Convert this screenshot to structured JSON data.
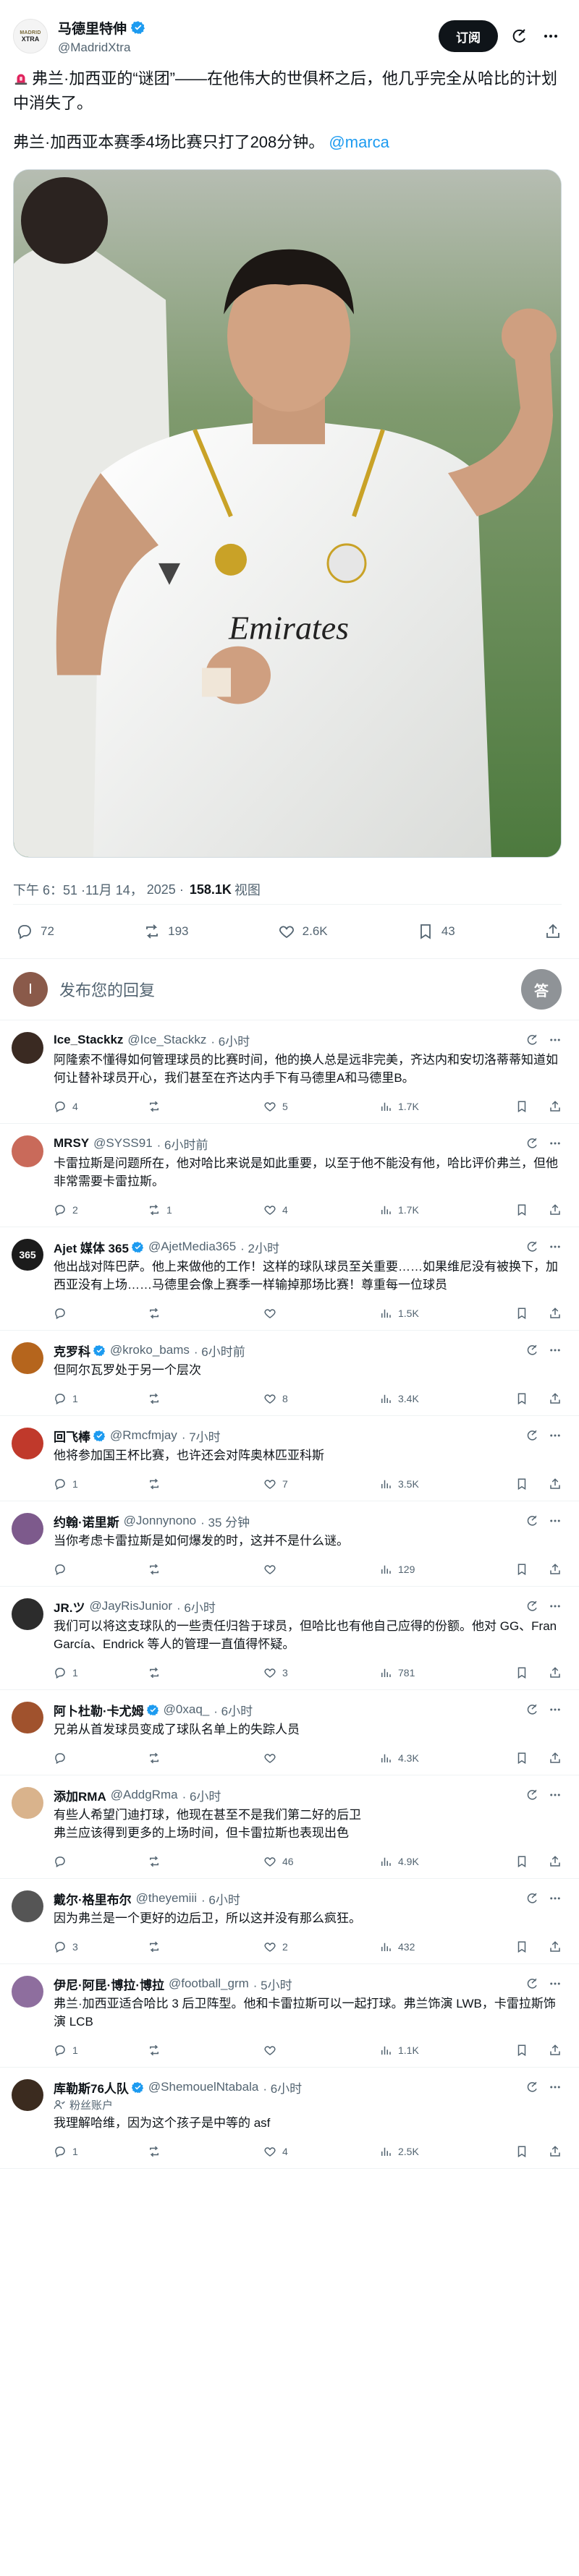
{
  "header": {
    "avatar_top": "MADRID",
    "avatar_bottom": "XTRA",
    "name": "马德里特伸",
    "handle": "@MadridXtra",
    "subscribe_label": "订阅"
  },
  "post": {
    "text_1": "弗兰·加西亚的“谜团”——在他伟大的世俱杯之后，他几乎完全从哈比的计划中消失了。",
    "text_2": "弗兰·加西亚本赛季4场比赛只打了208分钟。",
    "mention": "@marca",
    "image_jersey_sponsor": "Emirates",
    "time": "下午 6：51 ·11月 14，",
    "year": "2025",
    "views": "158.1K",
    "views_label": "视图",
    "replies": "72",
    "reposts": "193",
    "likes": "2.6K",
    "bookmarks": "43"
  },
  "reply_box": {
    "avatar_letter": "I",
    "placeholder": "发布您的回复",
    "button_label": "答"
  },
  "replies": [
    {
      "name": "Ice_Stackkz",
      "handle": "@Ice_Stackkz",
      "time": "· 6小时",
      "verified": false,
      "text": "阿隆索不懂得如何管理球员的比赛时间，他的换人总是远非完美，齐达内和安切洛蒂蒂知道如何让替补球员开心，我们甚至在齐达内手下有马德里A和马德里B。",
      "replies": "4",
      "reposts": "",
      "likes": "5",
      "views": "1.7K",
      "color": "#3a2a22"
    },
    {
      "name": "MRSY",
      "handle": "@SYSS91",
      "time": "· 6小时前",
      "verified": false,
      "text": "卡雷拉斯是问题所在，他对哈比来说是如此重要，以至于他不能没有他，哈比评价弗兰，但他非常需要卡雷拉斯。",
      "replies": "2",
      "reposts": "1",
      "likes": "4",
      "views": "1.7K",
      "color": "#c96a5a"
    },
    {
      "name": "Ajet 媒体 365",
      "handle": "@AjetMedia365",
      "time": "· 2小时",
      "verified": true,
      "text": "他出战对阵巴萨。他上来做他的工作！这样的球队球员至关重要……如果维尼没有被换下，加西亚没有上场……马德里会像上赛季一样输掉那场比赛！尊重每一位球员",
      "replies": "",
      "reposts": "",
      "likes": "",
      "views": "1.5K",
      "color": "#1b1b1b",
      "avatar_text": "365"
    },
    {
      "name": "克罗科",
      "handle": "@kroko_bams",
      "time": "· 6小时前",
      "verified": true,
      "text": "但阿尔瓦罗处于另一个层次",
      "replies": "1",
      "reposts": "",
      "likes": "8",
      "views": "3.4K",
      "color": "#b5651d"
    },
    {
      "name": "回飞棒",
      "handle": "@Rmcfmjay",
      "time": "· 7小时",
      "verified": true,
      "text": "他将参加国王杯比赛，也许还会对阵奥林匹亚科斯",
      "replies": "1",
      "reposts": "",
      "likes": "7",
      "views": "3.5K",
      "color": "#c0392b"
    },
    {
      "name": "约翰·诺里斯",
      "handle": "@Jonnynono",
      "time": "· 35 分钟",
      "verified": false,
      "text": "当你考虑卡雷拉斯是如何爆发的时，这并不是什么谜。",
      "replies": "",
      "reposts": "",
      "likes": "",
      "views": "129",
      "color": "#7d5a8c"
    },
    {
      "name": "JR.ツ",
      "handle": "@JayRisJunior",
      "time": "· 6小时",
      "verified": false,
      "text": "我们可以将这支球队的一些责任归咎于球员，但哈比也有他自己应得的份额。他对 GG、Fran García、Endrick 等人的管理一直值得怀疑。",
      "replies": "1",
      "reposts": "",
      "likes": "3",
      "views": "781",
      "color": "#2c2c2c"
    },
    {
      "name": "阿卜杜勒·卡尤姆",
      "handle": "@0xaq_",
      "time": "· 6小时",
      "verified": true,
      "text": "兄弟从首发球员变成了球队名单上的失踪人员",
      "replies": "",
      "reposts": "",
      "likes": "",
      "views": "4.3K",
      "color": "#a0522d"
    },
    {
      "name": "添加RMA",
      "handle": "@AddgRma",
      "time": "· 6小时",
      "verified": false,
      "text": "有些人希望门迪打球，他现在甚至不是我们第二好的后卫\n弗兰应该得到更多的上场时间，但卡雷拉斯也表现出色",
      "replies": "",
      "reposts": "",
      "likes": "46",
      "views": "4.9K",
      "color": "#d9b38c"
    },
    {
      "name": "戴尔·格里布尔",
      "handle": "@theyemiii",
      "time": "· 6小时",
      "verified": false,
      "text": "因为弗兰是一个更好的边后卫，所以这并没有那么疯狂。",
      "replies": "3",
      "reposts": "",
      "likes": "2",
      "views": "432",
      "color": "#555"
    },
    {
      "name": "伊尼·阿昆·博拉·博拉",
      "handle": "@football_grm",
      "time": "· 5小时",
      "verified": false,
      "text": "弗兰·加西亚适合哈比 3 后卫阵型。他和卡雷拉斯可以一起打球。弗兰饰演 LWB，卡雷拉斯饰演 LCB",
      "replies": "1",
      "reposts": "",
      "likes": "",
      "views": "1.1K",
      "color": "#8e6e9e"
    },
    {
      "name": "库勒斯76人队",
      "handle": "@ShemouelNtabala",
      "time": "· 6小时",
      "verified": true,
      "badge": "粉丝账户",
      "text": "我理解哈维，因为这个孩子是中等的 asf",
      "replies": "1",
      "reposts": "",
      "likes": "4",
      "views": "2.5K",
      "color": "#3b2b1f"
    }
  ]
}
